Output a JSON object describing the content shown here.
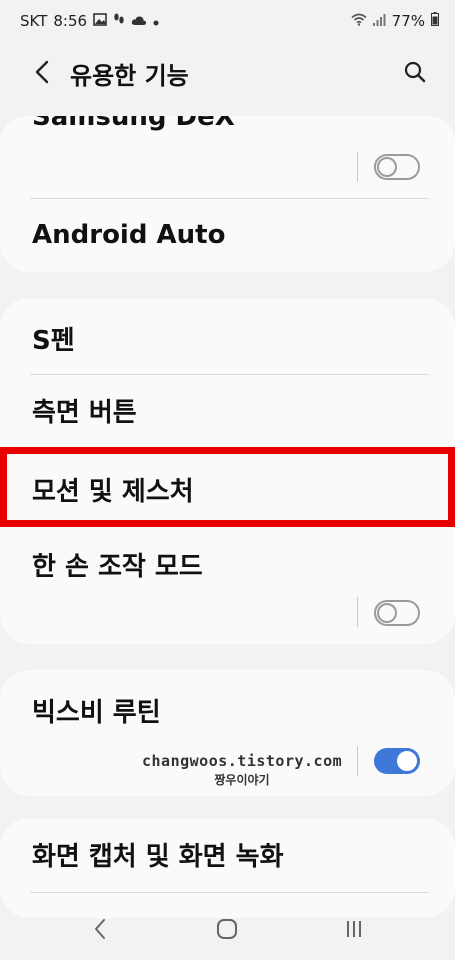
{
  "status_bar": {
    "carrier": "SKT",
    "time": "8:56",
    "battery": "77%",
    "icons": [
      "gallery-icon",
      "footprint-icon",
      "cloud-icon",
      "dot-icon",
      "wifi-icon",
      "signal-icon",
      "battery-icon"
    ]
  },
  "header": {
    "title": "유용한 기능",
    "back_icon": "back-arrow-icon",
    "search_icon": "search-icon"
  },
  "cards": [
    {
      "items": [
        {
          "label": "Samsung DeX",
          "toggle": "off"
        },
        {
          "label": "Android Auto"
        }
      ]
    },
    {
      "items": [
        {
          "label": "S펜"
        },
        {
          "label": "측면 버튼"
        },
        {
          "label": "모션 및 제스처",
          "highlighted": true
        },
        {
          "label": "한 손 조작 모드",
          "toggle": "off"
        }
      ]
    },
    {
      "items": [
        {
          "label": "빅스비 루틴",
          "toggle": "on"
        }
      ]
    },
    {
      "items": [
        {
          "label": "화면 캡처 및 화면 녹화"
        }
      ]
    }
  ],
  "watermark": {
    "line1": "changwoos.tistory.com",
    "line2": "짱우이야기"
  },
  "colors": {
    "highlight": "#e60000",
    "toggle_on": "#3e78d8",
    "background": "#f2f2f2",
    "card": "#fafafa"
  },
  "navbar": {
    "icons": [
      "nav-back-icon",
      "nav-home-icon",
      "nav-recents-icon"
    ]
  }
}
